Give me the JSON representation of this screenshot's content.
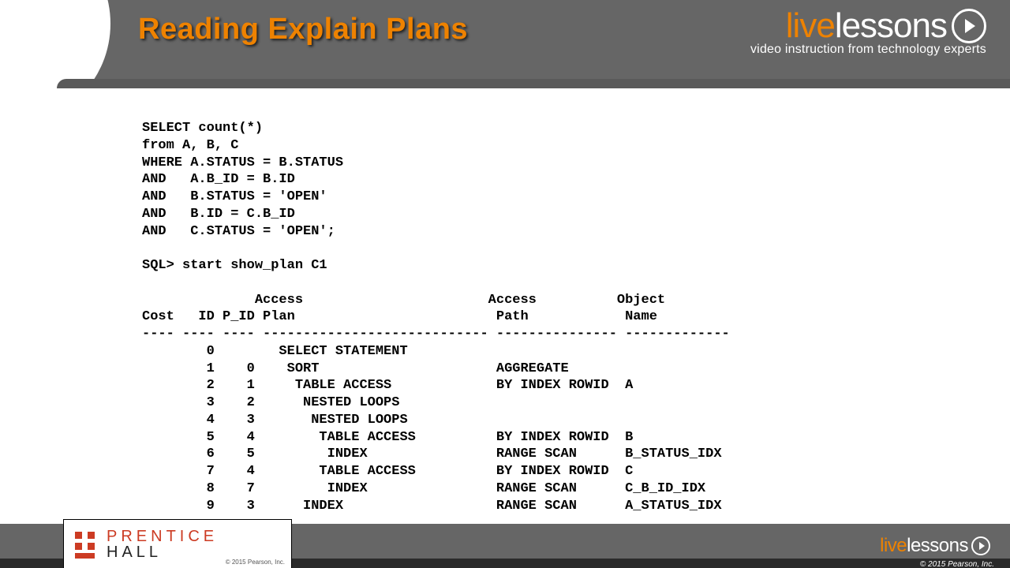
{
  "slide": {
    "title": "Reading Explain Plans"
  },
  "brand": {
    "live": "live",
    "lessons": "lessons",
    "tagline": "video instruction from technology experts"
  },
  "sql": {
    "lines": [
      "SELECT count(*)",
      "from A, B, C",
      "WHERE A.STATUS = B.STATUS",
      "AND   A.B_ID = B.ID",
      "AND   B.STATUS = 'OPEN'",
      "AND   B.ID = C.B_ID",
      "AND   C.STATUS = 'OPEN';"
    ],
    "prompt": "SQL> start show_plan C1"
  },
  "plan": {
    "header1": "              Access                       Access          Object",
    "header2": "Cost   ID P_ID Plan                         Path            Name",
    "divider": "---- ---- ---- ---------------------------- --------------- -------------",
    "rows": [
      {
        "cost": "",
        "id": "0",
        "pid": "",
        "plan": "SELECT STATEMENT",
        "path": "",
        "obj": ""
      },
      {
        "cost": "",
        "id": "1",
        "pid": "0",
        "plan": " SORT",
        "path": "AGGREGATE",
        "obj": ""
      },
      {
        "cost": "",
        "id": "2",
        "pid": "1",
        "plan": "  TABLE ACCESS",
        "path": "BY INDEX ROWID",
        "obj": "A"
      },
      {
        "cost": "",
        "id": "3",
        "pid": "2",
        "plan": "   NESTED LOOPS",
        "path": "",
        "obj": ""
      },
      {
        "cost": "",
        "id": "4",
        "pid": "3",
        "plan": "    NESTED LOOPS",
        "path": "",
        "obj": ""
      },
      {
        "cost": "",
        "id": "5",
        "pid": "4",
        "plan": "     TABLE ACCESS",
        "path": "BY INDEX ROWID",
        "obj": "B"
      },
      {
        "cost": "",
        "id": "6",
        "pid": "5",
        "plan": "      INDEX",
        "path": "RANGE SCAN",
        "obj": "B_STATUS_IDX"
      },
      {
        "cost": "",
        "id": "7",
        "pid": "4",
        "plan": "     TABLE ACCESS",
        "path": "BY INDEX ROWID",
        "obj": "C"
      },
      {
        "cost": "",
        "id": "8",
        "pid": "7",
        "plan": "      INDEX",
        "path": "RANGE SCAN",
        "obj": "C_B_ID_IDX"
      },
      {
        "cost": "",
        "id": "9",
        "pid": "3",
        "plan": "   INDEX",
        "path": "RANGE SCAN",
        "obj": "A_STATUS_IDX"
      }
    ]
  },
  "publisher": {
    "row1": "PRENTICE",
    "row2": "HALL",
    "copy": "© 2015 Pearson, Inc."
  },
  "footer": {
    "copyright": "© 2015 Pearson, Inc."
  }
}
